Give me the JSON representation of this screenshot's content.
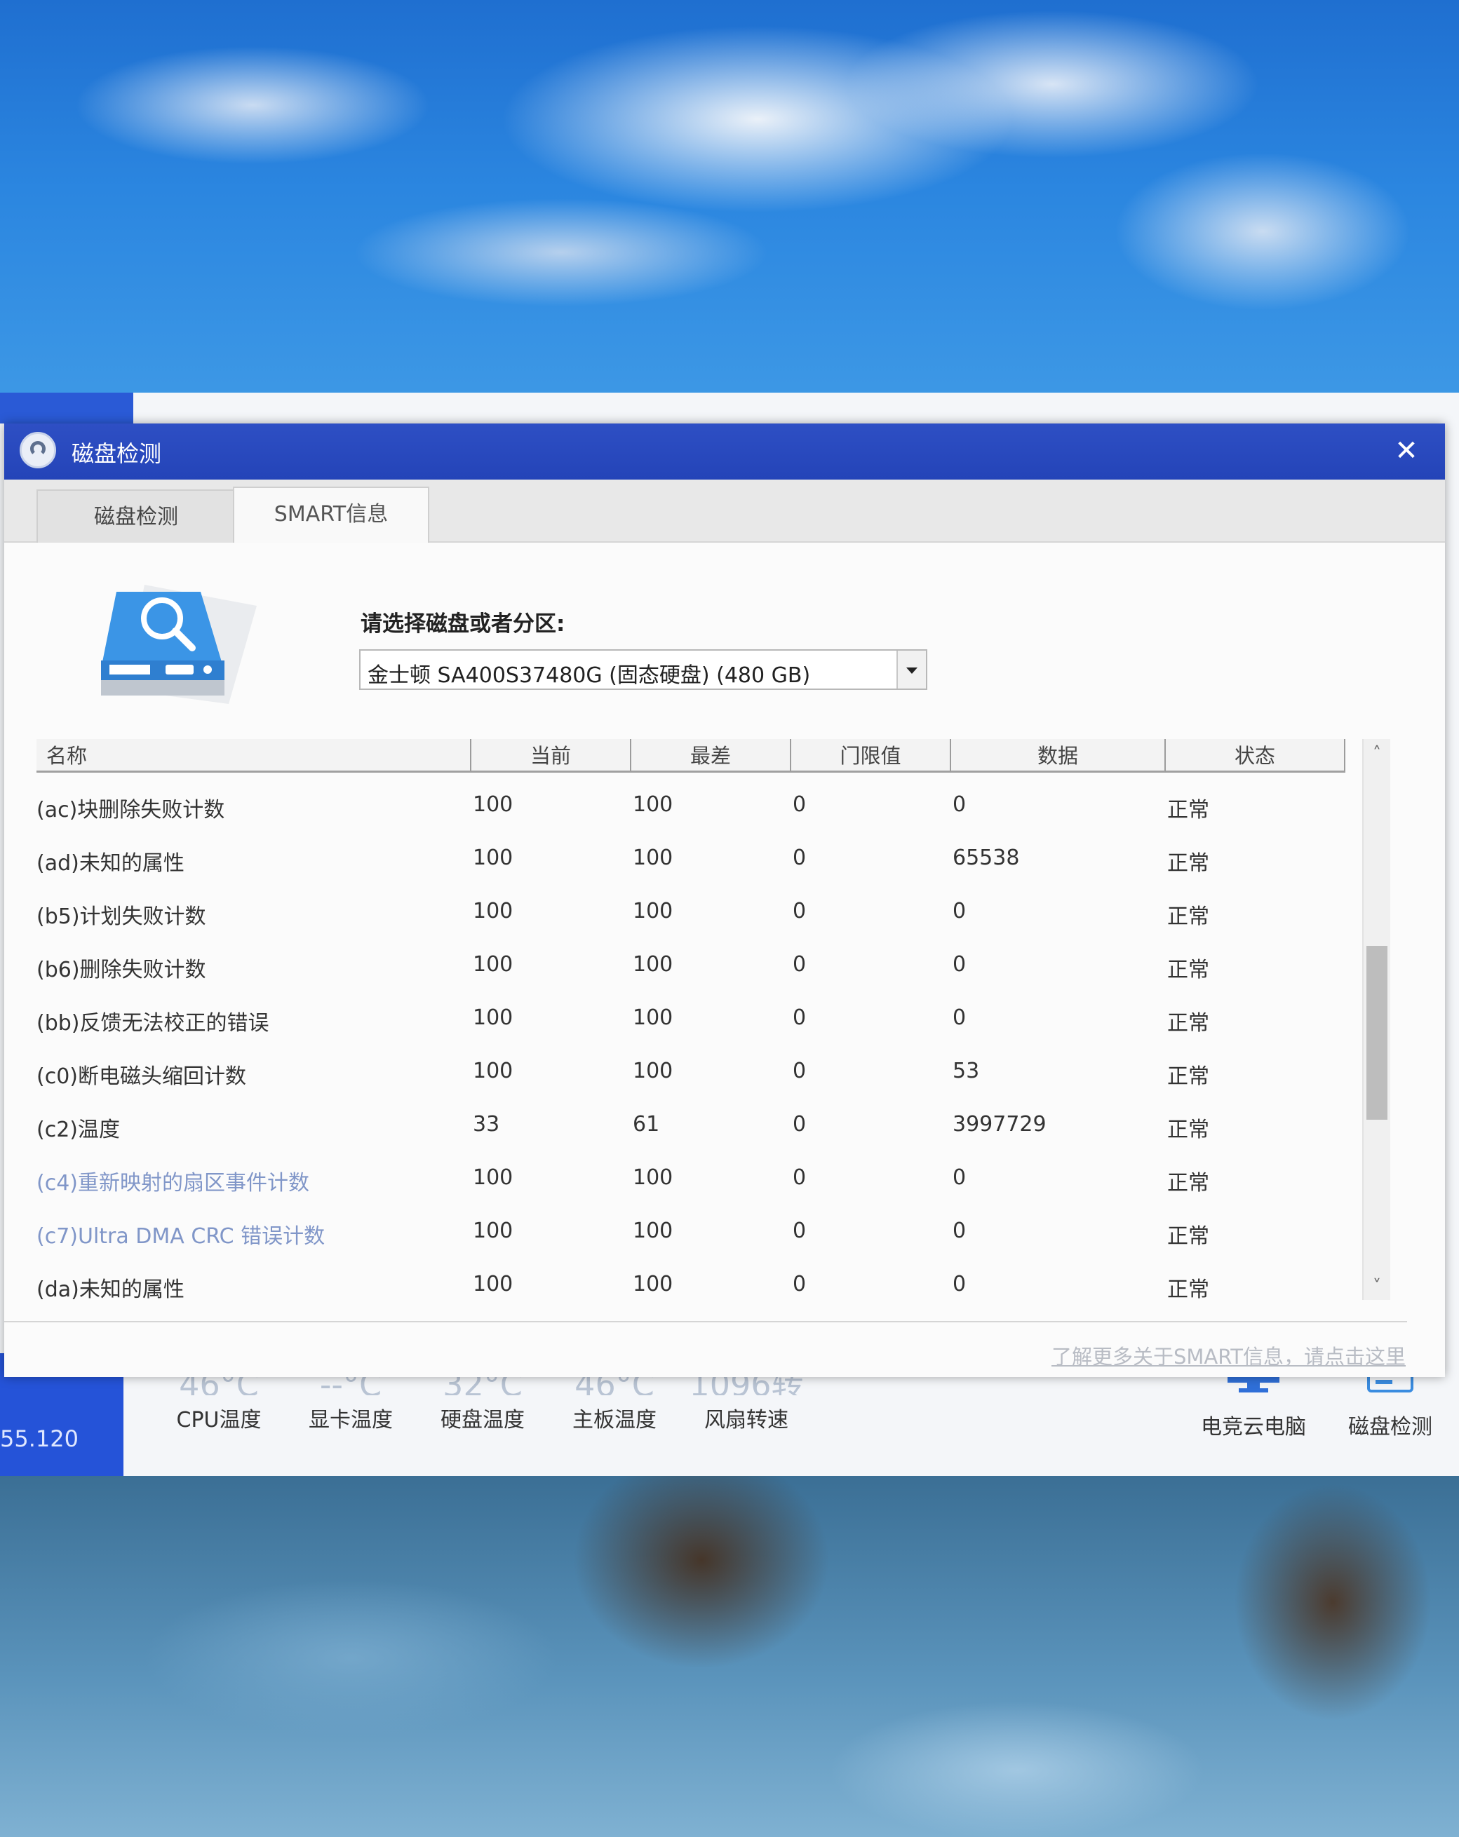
{
  "window": {
    "title": "磁盘检测"
  },
  "tabs": [
    {
      "label": "磁盘检测",
      "active": false
    },
    {
      "label": "SMART信息",
      "active": true
    }
  ],
  "disk_select": {
    "label": "请选择磁盘或者分区:",
    "value": "金士顿  SA400S37480G (固态硬盘)  (480 GB)"
  },
  "table": {
    "headers": [
      "名称",
      "当前",
      "最差",
      "门限值",
      "数据",
      "状态"
    ],
    "rows": [
      {
        "name": "(ac)块删除失败计数",
        "current": "100",
        "worst": "100",
        "threshold": "0",
        "data": "0",
        "status": "正常"
      },
      {
        "name": "(ad)未知的属性",
        "current": "100",
        "worst": "100",
        "threshold": "0",
        "data": "65538",
        "status": "正常"
      },
      {
        "name": "(b5)计划失败计数",
        "current": "100",
        "worst": "100",
        "threshold": "0",
        "data": "0",
        "status": "正常"
      },
      {
        "name": "(b6)删除失败计数",
        "current": "100",
        "worst": "100",
        "threshold": "0",
        "data": "0",
        "status": "正常"
      },
      {
        "name": "(bb)反馈无法校正的错误",
        "current": "100",
        "worst": "100",
        "threshold": "0",
        "data": "0",
        "status": "正常"
      },
      {
        "name": "(c0)断电磁头缩回计数",
        "current": "100",
        "worst": "100",
        "threshold": "0",
        "data": "53",
        "status": "正常"
      },
      {
        "name": "(c2)温度",
        "current": "33",
        "worst": "61",
        "threshold": "0",
        "data": "3997729",
        "status": "正常"
      },
      {
        "name": "(c4)重新映射的扇区事件计数",
        "current": "100",
        "worst": "100",
        "threshold": "0",
        "data": "0",
        "status": "正常"
      },
      {
        "name": "(c7)Ultra DMA CRC 错误计数",
        "current": "100",
        "worst": "100",
        "threshold": "0",
        "data": "0",
        "status": "正常"
      },
      {
        "name": "(da)未知的属性",
        "current": "100",
        "worst": "100",
        "threshold": "0",
        "data": "0",
        "status": "正常"
      }
    ]
  },
  "footer_link": "了解更多关于SMART信息，请点击这里",
  "background_app": {
    "ip_fragment": "55.120",
    "stats": [
      {
        "value": "46°C",
        "label": "CPU温度"
      },
      {
        "value": "--°C",
        "label": "显卡温度"
      },
      {
        "value": "32°C",
        "label": "硬盘温度"
      },
      {
        "value": "46°C",
        "label": "主板温度"
      },
      {
        "value": "1096转",
        "label": "风扇转速"
      }
    ],
    "tools": [
      {
        "label": "电竞云电脑",
        "icon": "monitor-icon"
      },
      {
        "label": "磁盘检测",
        "icon": "disk-icon"
      }
    ]
  },
  "colors": {
    "titlebar": "#2444b8",
    "sidebar": "#2553d8",
    "disk_icon": "#2f8fe0"
  }
}
